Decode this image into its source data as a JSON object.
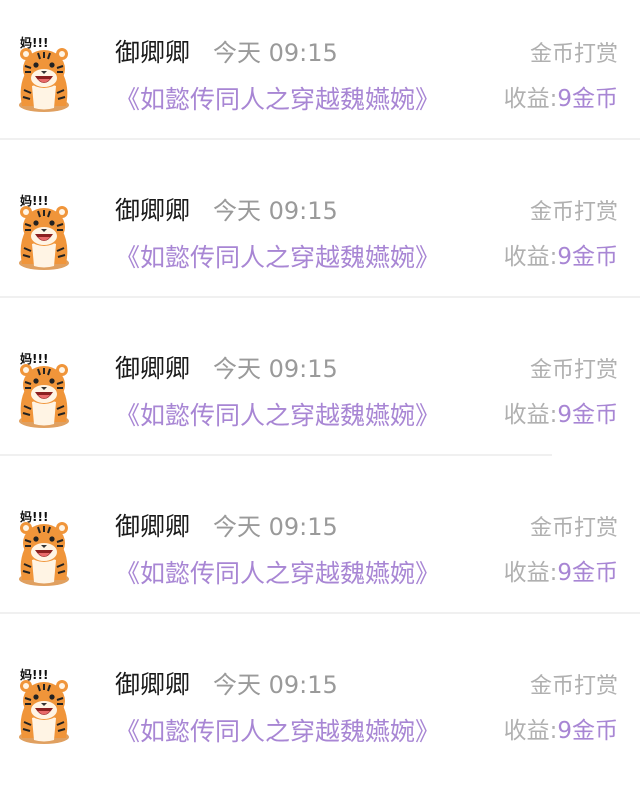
{
  "colors": {
    "accent": "#a886d4",
    "muted": "#9a9a9a",
    "divider": "#f0f0f0"
  },
  "avatar": {
    "icon": "tiger-sticker-icon",
    "sticker_text": "妈!!!"
  },
  "records": [
    {
      "user": "御卿卿",
      "time": "今天 09:15",
      "type": "金币打赏",
      "book": "《如懿传同人之穿越魏嬿婉》",
      "earn_label": "收益:",
      "earn_value": "9金币"
    },
    {
      "user": "御卿卿",
      "time": "今天 09:15",
      "type": "金币打赏",
      "book": "《如懿传同人之穿越魏嬿婉》",
      "earn_label": "收益:",
      "earn_value": "9金币"
    },
    {
      "user": "御卿卿",
      "time": "今天 09:15",
      "type": "金币打赏",
      "book": "《如懿传同人之穿越魏嬿婉》",
      "earn_label": "收益:",
      "earn_value": "9金币"
    },
    {
      "user": "御卿卿",
      "time": "今天 09:15",
      "type": "金币打赏",
      "book": "《如懿传同人之穿越魏嬿婉》",
      "earn_label": "收益:",
      "earn_value": "9金币"
    },
    {
      "user": "御卿卿",
      "time": "今天 09:15",
      "type": "金币打赏",
      "book": "《如懿传同人之穿越魏嬿婉》",
      "earn_label": "收益:",
      "earn_value": "9金币"
    }
  ]
}
